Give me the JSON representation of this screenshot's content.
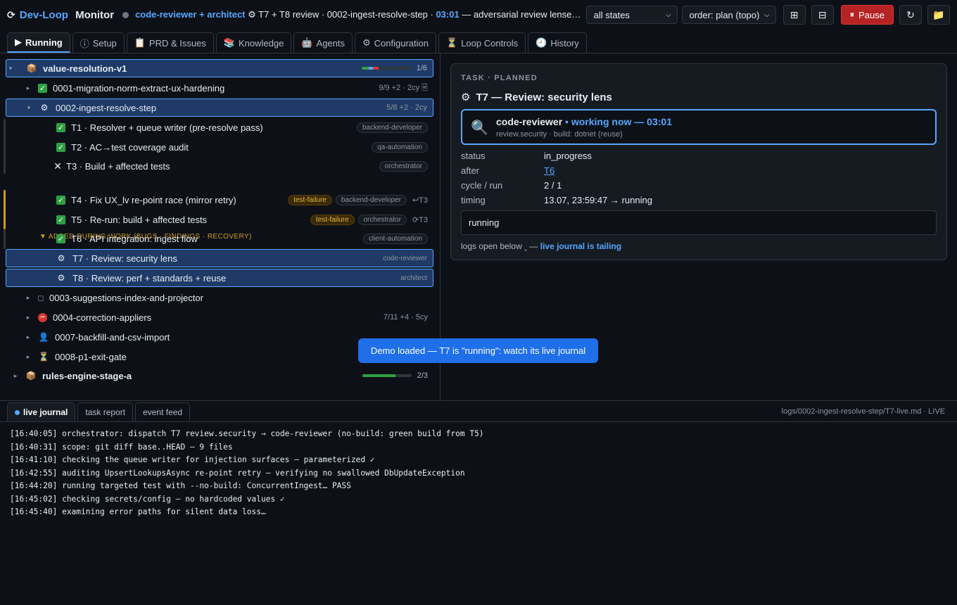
{
  "header": {
    "brand_icon": "refresh-icon",
    "brand_part1": "Dev-Loop",
    "brand_part2": " Monitor",
    "who": "code-reviewer + architect",
    "summary": " ⚙ T7 + T8 review · 0002-ingest-resolve-step · ",
    "elapsed": "03:01",
    "summary_tail": " — adversarial review lenses running in ...",
    "filter_select": "all states",
    "order_select": "order: plan (topo)",
    "pause_label": "Pause"
  },
  "tabs": [
    {
      "icon": "▶",
      "label": "Running"
    },
    {
      "icon": "ⓘ",
      "label": "Setup"
    },
    {
      "icon": "📋",
      "label": "PRD & Issues"
    },
    {
      "icon": "📚",
      "label": "Knowledge"
    },
    {
      "icon": "🤖",
      "label": "Agents"
    },
    {
      "icon": "⚙",
      "label": "Configuration"
    },
    {
      "icon": "⏳",
      "label": "Loop Controls"
    },
    {
      "icon": "🕘",
      "label": "History"
    }
  ],
  "tree": {
    "section_note": "▼ ADDED DURING WORK (BUGS · FINDINGS · RECOVERY)",
    "rows": [
      {
        "label": "value-resolution-v1",
        "meta": "1/6",
        "progress": 0.17
      },
      {
        "label": "0001-migration-norm-extract-ux-hardening",
        "meta": "9/9 +2 · 2cy 🗎"
      },
      {
        "label": "0002-ingest-resolve-step",
        "meta": "5/8 +2 · 2cy"
      },
      {
        "label": "T1 · Resolver + queue writer (pre-resolve pass)",
        "tag": "backend-developer"
      },
      {
        "label": "T2 · AC→test coverage audit",
        "tag": "qa-automation"
      },
      {
        "label": "T3 · Build + affected tests",
        "tag": "orchestrator"
      },
      {
        "label": "T4 · Fix UX_lv re-point race (mirror retry)",
        "flag": "test-failure",
        "tag": "backend-developer",
        "dep": "↩T3"
      },
      {
        "label": "T5 · Re-run: build + affected tests",
        "flag": "test-failure",
        "tag": "orchestrator",
        "dep": "⟳T3"
      },
      {
        "label": "T6 · API integration: ingest flow",
        "tag": "client-automation"
      },
      {
        "label": "T7 · Review: security lens",
        "tag": "code-reviewer"
      },
      {
        "label": "T8 · Review: perf + standards + reuse",
        "tag": "architect"
      },
      {
        "label": "0003-suggestions-index-and-projector"
      },
      {
        "label": "0004-correction-appliers",
        "meta": "7/11 +4 · 5cy"
      },
      {
        "label": "0007-backfill-and-csv-import"
      },
      {
        "label": "0008-p1-exit-gate"
      },
      {
        "label": "rules-engine-stage-a",
        "meta": "2/3",
        "progress": 0.67
      }
    ]
  },
  "detail": {
    "kicker": "TASK · PLANNED",
    "title": "T7 — Review: security lens",
    "agent": "code-reviewer",
    "agent_status": " • working now — 03:01",
    "agent_sub": "review.security · build: dotnet (reuse)",
    "fields": [
      {
        "k": "status",
        "v": "in_progress"
      },
      {
        "k": "after",
        "v": "T6"
      },
      {
        "k": "cycle / run",
        "v": "2 / 1"
      },
      {
        "k": "timing",
        "v": "13.07, 23:59:47 → running"
      }
    ],
    "state_text": "running",
    "logs_note": "logs open below ˬ — ",
    "logs_note_hl": "live journal is tailing"
  },
  "toast": "Demo loaded — T7 is \"running\": watch its live journal",
  "log_tabs": [
    "live journal",
    "task report",
    "event feed"
  ],
  "log_path": "logs/0002-ingest-resolve-step/T7-live.md · LIVE",
  "log_lines": [
    "[16:40:05] orchestrator: dispatch T7 review.security → code-reviewer (no-build: green build from T5)",
    "[16:40:31] scope: git diff base..HEAD — 9 files",
    "[16:41:10] checking the queue writer for injection surfaces — parameterized ✓",
    "[16:42:55] auditing UpsertLookupsAsync re-point retry — verifying no swallowed DbUpdateException",
    "[16:44:20] running targeted test with --no-build: ConcurrentIngest… PASS",
    "[16:45:02] checking secrets/config — no hardcoded values ✓",
    "[16:45:40] examining error paths for silent data loss…"
  ],
  "colors": {
    "accent": "#58a6ff",
    "danger": "#b62324",
    "success": "#2ea043",
    "warning": "#d29922"
  }
}
